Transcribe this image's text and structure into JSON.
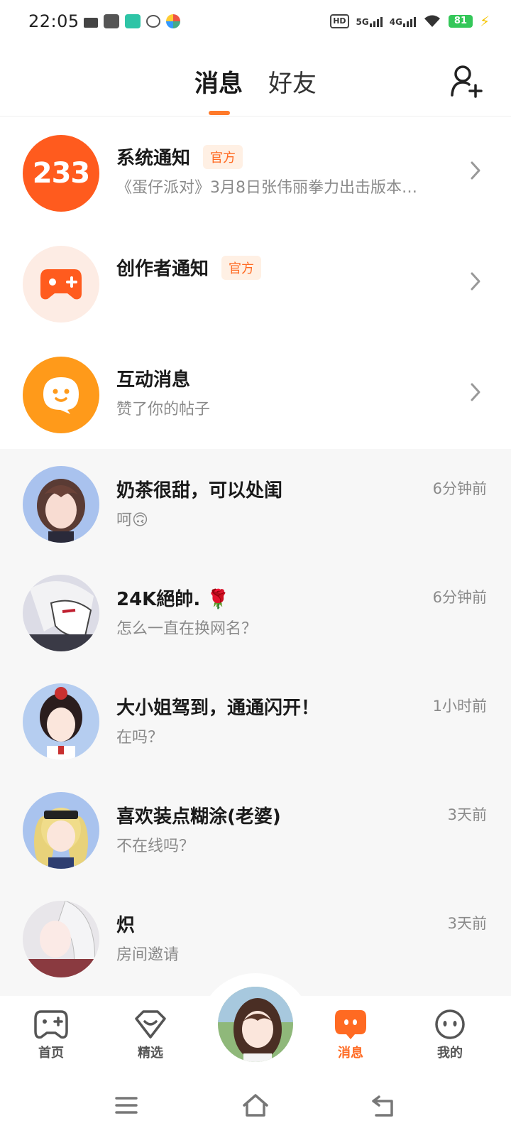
{
  "status_bar": {
    "time": "22:05",
    "hd": "HD",
    "net1": "5G",
    "net2": "4G",
    "battery": "81"
  },
  "top_tabs": {
    "active": "消息",
    "inactive": "好友"
  },
  "notifications": [
    {
      "title": "系统通知",
      "badge": "官方",
      "subtitle": "《蛋仔派对》3月8日张伟丽拳力出击版本…",
      "avatar_text": "233",
      "avatar_color": "#ff5b1e",
      "icon": "233-logo-icon"
    },
    {
      "title": "创作者通知",
      "badge": "官方",
      "subtitle": "",
      "avatar_color": "#fdece4",
      "icon": "gamepad-plus-icon"
    },
    {
      "title": "互动消息",
      "badge": "",
      "subtitle": "赞了你的帖子",
      "avatar_color": "#ff9a1a",
      "icon": "smile-bubble-icon"
    }
  ],
  "chats": [
    {
      "name": "奶茶很甜，可以处闺",
      "message": "呵🙃",
      "time": "6分钟前"
    },
    {
      "name": "24K絕帥.  🌹",
      "message": "怎么一直在换网名？",
      "time": "6分钟前"
    },
    {
      "name": "大小姐驾到，通通闪开！",
      "message": "在吗？",
      "time": "1小时前"
    },
    {
      "name": "喜欢装点糊涂(老婆)",
      "message": "不在线吗？",
      "time": "3天前"
    },
    {
      "name": "炽",
      "message": "房间邀请",
      "time": "3天前"
    }
  ],
  "bottom_nav": {
    "home": "首页",
    "featured": "精选",
    "messages": "消息",
    "mine": "我的"
  },
  "colors": {
    "accent": "#ff6a22",
    "badge_bg": "#fff0e4"
  }
}
